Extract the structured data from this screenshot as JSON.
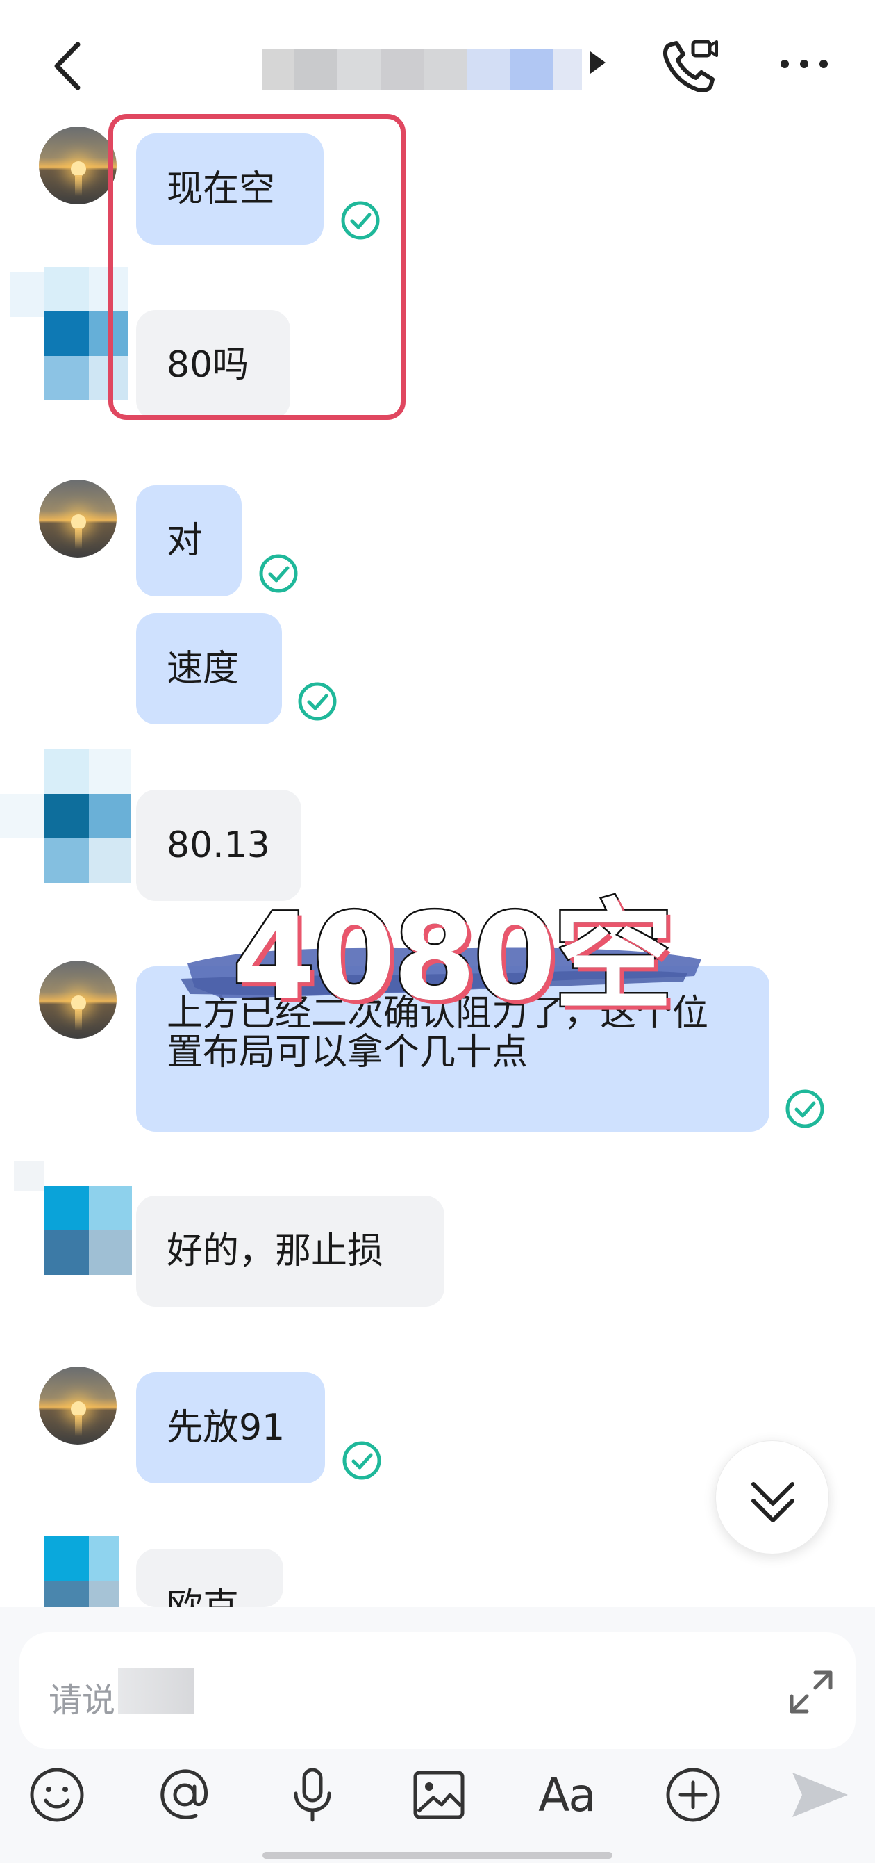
{
  "header": {
    "back_icon": "chevron-left-icon",
    "contact_name": "",
    "call_icon": "phone-video-icon",
    "more_icon": "ellipsis-icon"
  },
  "messages": [
    {
      "from": "me",
      "text": "现在空",
      "read": true
    },
    {
      "from": "other",
      "text": "80吗"
    },
    {
      "from": "me",
      "text": "对",
      "read": true
    },
    {
      "from": "me",
      "text": "速度",
      "read": true
    },
    {
      "from": "other",
      "text": "80.13"
    },
    {
      "from": "me",
      "text": "上方已经二次确认阻力了，这个位置布局可以拿个几十点",
      "read": true
    },
    {
      "from": "other",
      "text": "好的，那止损"
    },
    {
      "from": "me",
      "text": "先放91",
      "read": true
    },
    {
      "from": "other",
      "text": "欧克"
    }
  ],
  "overlay": {
    "caption": "4080空",
    "accent": "#e04760"
  },
  "input": {
    "placeholder": "请说",
    "expand_icon": "expand-arrows-icon"
  },
  "toolbar": {
    "icons": [
      "emoji-icon",
      "mention-icon",
      "microphone-icon",
      "image-icon",
      "font-aa-icon",
      "plus-circle-icon",
      "send-icon"
    ],
    "font_label": "Aa"
  },
  "colors": {
    "my_bubble": "#cfe1fe",
    "other_bubble": "#f1f2f4",
    "read_check": "#1fb89a",
    "highlight": "#e04760"
  }
}
